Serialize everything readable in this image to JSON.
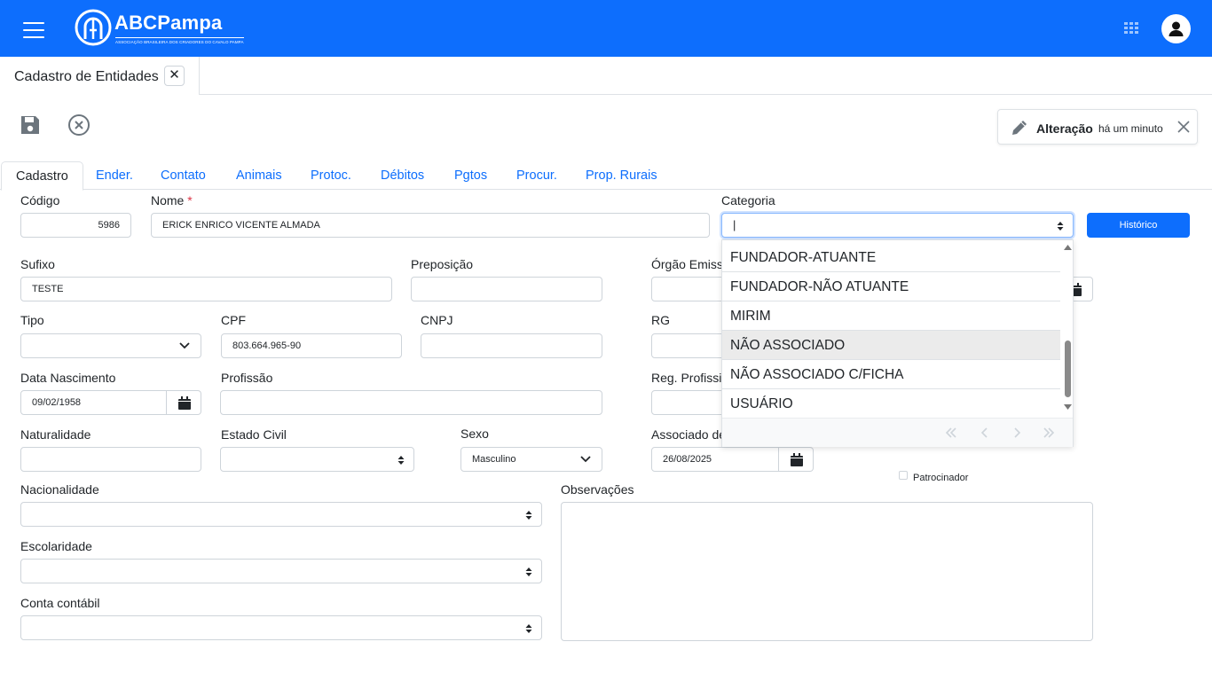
{
  "header": {
    "logo_title": "ABCPampa",
    "logo_subtitle": "ASSOCIAÇÃO BRASILEIRA DOS CRIADORES DO CAVALO PAMPA"
  },
  "doc_tab": {
    "label": "Cadastro de Entidades",
    "close": "✕"
  },
  "notification": {
    "title": "Alteração",
    "time": "há um minuto"
  },
  "tabs": [
    "Cadastro",
    "Ender.",
    "Contato",
    "Animais",
    "Protoc.",
    "Débitos",
    "Pgtos",
    "Procur.",
    "Prop. Rurais"
  ],
  "form": {
    "codigo": {
      "label": "Código",
      "value": "5986"
    },
    "nome": {
      "label": "Nome",
      "required_mark": "*",
      "value": "ERICK ENRICO VICENTE ALMADA"
    },
    "categoria": {
      "label": "Categoria",
      "value": "|"
    },
    "historico_button": "Histórico",
    "sufixo": {
      "label": "Sufixo",
      "value": "TESTE"
    },
    "preposicao": {
      "label": "Preposição",
      "value": ""
    },
    "orgao_emissor": {
      "label": "Órgão Emiss",
      "value": ""
    },
    "tipo": {
      "label": "Tipo",
      "value": ""
    },
    "cpf": {
      "label": "CPF",
      "value": "803.664.965-90"
    },
    "cnpj": {
      "label": "CNPJ",
      "value": ""
    },
    "rg": {
      "label": "RG",
      "value": ""
    },
    "data_nascimento": {
      "label": "Data Nascimento",
      "value": "09/02/1958"
    },
    "profissao": {
      "label": "Profissão",
      "value": ""
    },
    "reg_profissional": {
      "label": "Reg. Profissi",
      "value": ""
    },
    "naturalidade": {
      "label": "Naturalidade",
      "value": ""
    },
    "estado_civil": {
      "label": "Estado Civil",
      "value": ""
    },
    "sexo": {
      "label": "Sexo",
      "value": "Masculino"
    },
    "associado_desde": {
      "label": "Associado de",
      "value": "26/08/2025"
    },
    "patrocinador": {
      "label": "Patrocinador",
      "checked": false
    },
    "nacionalidade": {
      "label": "Nacionalidade",
      "value": ""
    },
    "observacoes": {
      "label": "Observações",
      "value": ""
    },
    "escolaridade": {
      "label": "Escolaridade",
      "value": ""
    },
    "conta_contabil": {
      "label": "Conta contábil",
      "value": ""
    }
  },
  "categoria_dropdown": {
    "options": [
      "FUNDADOR-ATUANTE",
      "FUNDADOR-NÃO ATUANTE",
      "MIRIM",
      "NÃO ASSOCIADO",
      "NÃO ASSOCIADO C/FICHA",
      "USUÁRIO"
    ],
    "highlighted": "NÃO ASSOCIADO"
  },
  "colors": {
    "primary": "#0d6efd",
    "border": "#ced4da",
    "required": "#dc3545"
  }
}
